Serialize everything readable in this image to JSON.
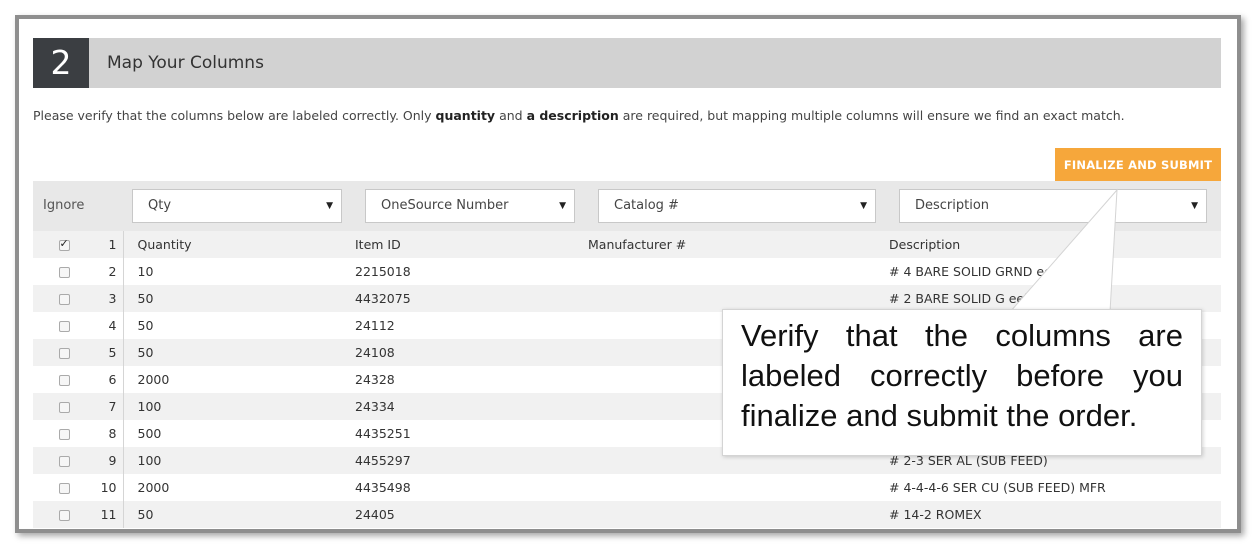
{
  "step": {
    "number": "2",
    "title": "Map Your Columns"
  },
  "instructions": {
    "part1": "Please verify that the columns below are labeled correctly. Only ",
    "bold1": "quantity",
    "part2": " and ",
    "bold2": "a description",
    "part3": " are required, but mapping multiple columns will ensure we find an exact match."
  },
  "finalize_button": "FINALIZE AND SUBMIT",
  "mapping": {
    "ignore_label": "Ignore",
    "selects": [
      {
        "value": "Qty"
      },
      {
        "value": "OneSource Number"
      },
      {
        "value": "Catalog #"
      },
      {
        "value": "Description"
      }
    ],
    "chevron_icon": "chevron-down-icon"
  },
  "rows": [
    {
      "num": "1",
      "checked": true,
      "c1": "Quantity",
      "c2": "Item ID",
      "c3": "Manufacturer #",
      "c4": "Description"
    },
    {
      "num": "2",
      "checked": false,
      "c1": "10",
      "c2": "2215018",
      "c3": "",
      "c4": "# 4 BARE SOLID GRND            eel)"
    },
    {
      "num": "3",
      "checked": false,
      "c1": "50",
      "c2": "4432075",
      "c3": "",
      "c4": "# 2 BARE SOLID G               eel)"
    },
    {
      "num": "4",
      "checked": false,
      "c1": "50",
      "c2": "24112",
      "c3": "",
      "c4": ""
    },
    {
      "num": "5",
      "checked": false,
      "c1": "50",
      "c2": "24108",
      "c3": "",
      "c4": ""
    },
    {
      "num": "6",
      "checked": false,
      "c1": "2000",
      "c2": "24328",
      "c3": "",
      "c4": ""
    },
    {
      "num": "7",
      "checked": false,
      "c1": "100",
      "c2": "24334",
      "c3": "",
      "c4": ""
    },
    {
      "num": "8",
      "checked": false,
      "c1": "500",
      "c2": "4435251",
      "c3": "",
      "c4": ""
    },
    {
      "num": "9",
      "checked": false,
      "c1": "100",
      "c2": "4455297",
      "c3": "",
      "c4": "# 2-3 SER AL (SUB FEED)"
    },
    {
      "num": "10",
      "checked": false,
      "c1": "2000",
      "c2": "4435498",
      "c3": "",
      "c4": "# 4-4-4-6 SER CU (SUB FEED) MFR"
    },
    {
      "num": "11",
      "checked": false,
      "c1": "50",
      "c2": "24405",
      "c3": "",
      "c4": "# 14-2 ROMEX"
    }
  ],
  "callout": {
    "text": "Verify that the columns are labeled correctly before you finalize and submit the order."
  },
  "colors": {
    "accent": "#f6a73b",
    "step_badge": "#3b3e42",
    "header_bar": "#d2d2d2"
  }
}
